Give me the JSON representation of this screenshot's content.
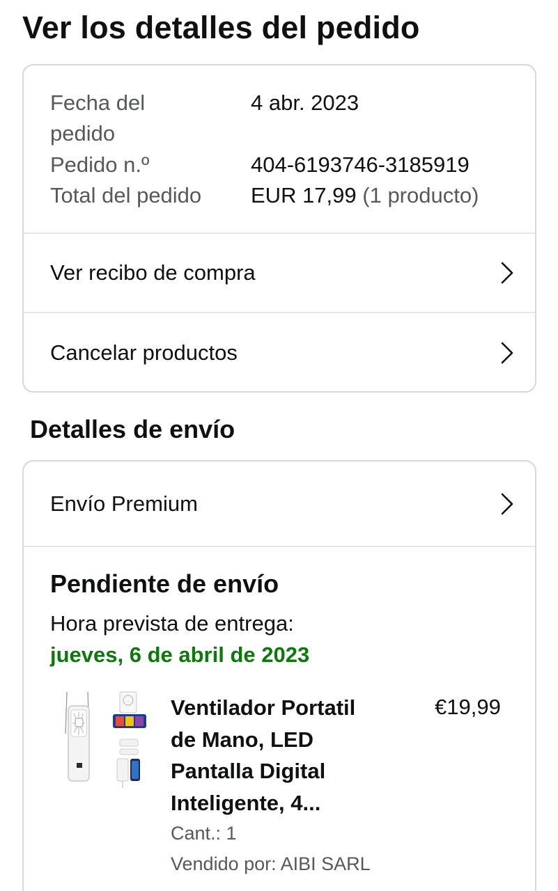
{
  "header": {
    "title": "Ver los detalles del pedido"
  },
  "order_summary": {
    "date_label_line1": "Fecha del",
    "date_label_line2": "pedido",
    "date_value": "4 abr. 2023",
    "number_label": "Pedido n.º",
    "number_value": "404-6193746-3185919",
    "total_label": "Total del pedido",
    "total_value": "EUR 17,99",
    "total_count": "(1 producto)"
  },
  "actions": {
    "receipt_label": "Ver recibo de compra",
    "cancel_label": "Cancelar productos"
  },
  "shipping": {
    "section_title": "Detalles de envío",
    "method_label": "Envío Premium",
    "status_title": "Pendiente de envío",
    "eta_label": "Hora prevista de entrega:",
    "eta_date": "jueves, 6 de abril de 2023",
    "eta_color": "#0b7a0b"
  },
  "product": {
    "title_line1": "Ventilador Portatil",
    "title_line2": "de Mano, LED",
    "title_line3": "Pantalla Digital",
    "title_line4": "Inteligente, 4...",
    "price": "€19,99",
    "quantity": "Cant.: 1",
    "seller": "Vendido por: AIBI SARL",
    "icon": "portable-fan-product-image"
  }
}
